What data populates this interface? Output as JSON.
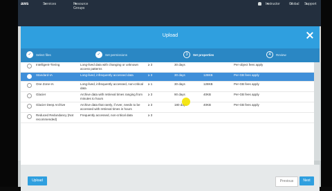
{
  "topnav": {
    "logo": "aws",
    "services": "Services",
    "resource_groups": "Resource Groups",
    "user": "Instructor",
    "region": "Global",
    "support": "Support"
  },
  "modal": {
    "title": "Upload",
    "steps": [
      {
        "label": "Select files",
        "state": "done"
      },
      {
        "label": "Set permissions",
        "state": "done"
      },
      {
        "label": "Set properties",
        "state": "active",
        "number": "3"
      },
      {
        "label": "Review",
        "state": "todo",
        "number": "4"
      }
    ]
  },
  "storage_classes": [
    {
      "name": "Intelligent-Tiering",
      "designed_for": "Long-lived data with changing or unknown access patterns",
      "azs": "≥ 3",
      "min_duration": "30 days",
      "min_size": "",
      "fees": "Per-object fees apply",
      "selected": false
    },
    {
      "name": "Standard-IA",
      "designed_for": "Long-lived, infrequently accessed data",
      "azs": "≥ 3",
      "min_duration": "30 days",
      "min_size": "128KB",
      "fees": "Per-GB fees apply",
      "selected": true
    },
    {
      "name": "One Zone-IA",
      "designed_for": "Long-lived, infrequently accessed, non-critical data",
      "azs": "≥ 1",
      "min_duration": "30 days",
      "min_size": "128KB",
      "fees": "Per-GB fees apply",
      "selected": false
    },
    {
      "name": "Glacier",
      "designed_for": "Archive data with retrieval times ranging from minutes to hours",
      "azs": "≥ 3",
      "min_duration": "90 days",
      "min_size": "40KB",
      "fees": "Per-GB fees apply",
      "selected": false
    },
    {
      "name": "Glacier Deep Archive",
      "designed_for": "Archive data that rarely, if ever, needs to be accessed with retrieval times in hours",
      "azs": "≥ 3",
      "min_duration": "180 days",
      "min_size": "40KB",
      "fees": "Per-GB fees apply",
      "selected": false
    },
    {
      "name": "Reduced Redundancy (Not recommended)",
      "designed_for": "Frequently accessed, non-critical data",
      "azs": "≥ 3",
      "min_duration": "",
      "min_size": "",
      "fees": "",
      "selected": false
    }
  ],
  "footer": {
    "upload": "Upload",
    "previous": "Previous",
    "next": "Next"
  },
  "colors": {
    "header_blue": "#2f9fdf",
    "selected_row": "#3f8fd9",
    "nav_dark": "#232f3e"
  }
}
